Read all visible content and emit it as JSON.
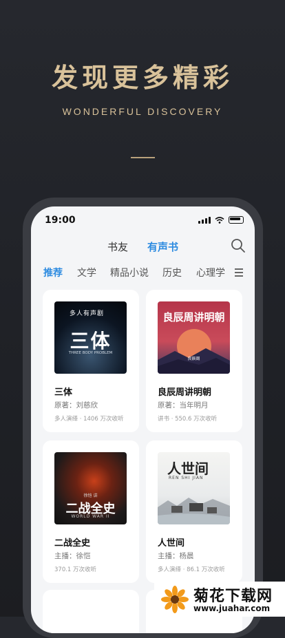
{
  "promo": {
    "title": "发现更多精彩",
    "subtitle": "WONDERFUL DISCOVERY"
  },
  "status": {
    "time": "19:00"
  },
  "header": {
    "tabs": [
      {
        "label": "书友",
        "active": false
      },
      {
        "label": "有声书",
        "active": true
      }
    ],
    "search_icon": "search-icon"
  },
  "categories": [
    {
      "label": "推荐",
      "active": true
    },
    {
      "label": "文学",
      "active": false
    },
    {
      "label": "精品小说",
      "active": false
    },
    {
      "label": "历史",
      "active": false
    },
    {
      "label": "心理学",
      "active": false
    }
  ],
  "books": [
    {
      "title": "三体",
      "author": "原著：刘慈欣",
      "stats": "多人演绎 · 1406 万次收听",
      "cover_text": "三体",
      "cover_badge": "多人有声剧",
      "cover_sub": "THREE BODY PROBLEM"
    },
    {
      "title": "良辰周讲明朝",
      "author": "原著：当年明月",
      "stats": "讲书 · 550.6 万次收听",
      "cover_text": "良辰周讲明朝",
      "cover_sub": "良辰周"
    },
    {
      "title": "二战全史",
      "author": "主播：徐恺",
      "stats": "370.1 万次收听",
      "cover_text": "二战全史",
      "cover_top": "徐恺 讲",
      "cover_sub": "WORLD WAR II"
    },
    {
      "title": "人世间",
      "author": "主播：杨晨",
      "stats": "多人演绎 · 86.1 万次收听",
      "cover_text": "人世间",
      "cover_sub": "REN SHI JIAN"
    }
  ],
  "watermark": {
    "title": "菊花下载网",
    "url": "www.juahar.com"
  },
  "colors": {
    "accent": "#2d8be0",
    "gold": "#d9c29a",
    "background": "#23252a"
  }
}
